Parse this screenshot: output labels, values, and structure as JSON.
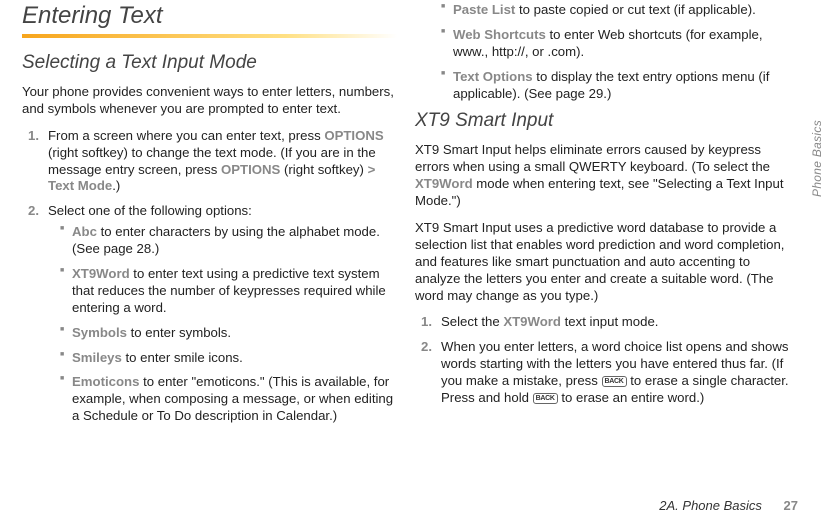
{
  "col1": {
    "h1": "Entering Text",
    "h2": "Selecting a Text Input Mode",
    "intro": "Your phone provides convenient ways to enter letters, numbers, and symbols whenever you are prompted to enter text.",
    "step1_a": "From a screen where you can enter text, press ",
    "step1_b": "OPTIONS",
    "step1_c": " (right softkey) to change the text mode. (If you are in the message entry screen, press ",
    "step1_d": "OPTIONS",
    "step1_e": " (right softkey) ",
    "step1_f": "> Text Mode",
    "step1_g": ".)",
    "step2": "Select one of the following options:",
    "b1_a": "Abc",
    "b1_b": " to enter characters by using the alphabet mode. (See page 28.)",
    "b2_a": "XT9Word",
    "b2_b": " to enter text using a predictive text system that reduces the number of keypresses required while entering a word.",
    "b3_a": "Symbols",
    "b3_b": " to enter symbols.",
    "b4_a": "Smileys",
    "b4_b": " to enter smile icons.",
    "b5_a": "Emoticons",
    "b5_b": " to enter \"emoticons.\" (This is available, for example, when composing a message, or when editing a Schedule or To Do description in Calendar.)"
  },
  "col2": {
    "b6_a": "Paste List",
    "b6_b": " to paste copied or cut text (if applicable).",
    "b7_a": "Web Shortcuts",
    "b7_b": " to enter Web shortcuts (for example, www., http://, or .com).",
    "b8_a": "Text Options",
    "b8_b": " to display the text entry options menu (if applicable). (See page 29.)",
    "h2": "XT9 Smart Input",
    "p1_a": "XT9 Smart Input helps eliminate errors caused by keypress errors when using a small QWERTY keyboard. (To select the ",
    "p1_b": "XT9Word",
    "p1_c": " mode when entering text, see \"Selecting a Text Input Mode.\")",
    "p2": "XT9 Smart Input uses a predictive word database to provide a selection list that enables word prediction and word completion, and features like smart punctuation and auto accenting to analyze the letters you enter and create a suitable word. (The word may change as you type.)",
    "s1_a": "Select the ",
    "s1_b": "XT9Word",
    "s1_c": " text input mode.",
    "s2_a": "When you enter letters, a word choice list opens and shows words starting with the letters you have entered thus far. (If you make a mistake, press ",
    "s2_b": " to erase a single character. Press and hold ",
    "s2_c": " to erase an entire word.)",
    "back_label": "BACK"
  },
  "sidetab": "Phone Basics",
  "footer_section": "2A. Phone Basics",
  "footer_page": "27"
}
